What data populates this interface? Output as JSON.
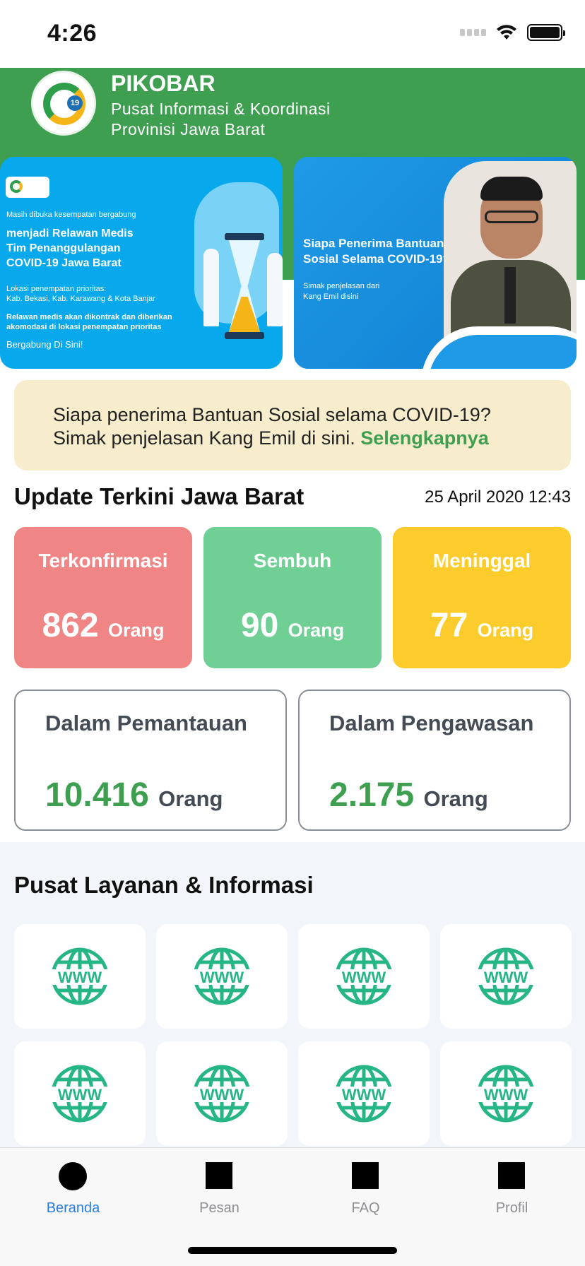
{
  "status_bar": {
    "time": "4:26"
  },
  "header": {
    "title": "PIKOBAR",
    "subtitle_line1": "Pusat Informasi & Koordinasi",
    "subtitle_line2": "Provinisi Jawa Barat"
  },
  "banners": [
    {
      "small": "Masih dibuka kesempatan bergabung",
      "headline": "menjadi Relawan Medis\nTim Penanggulangan\nCOVID-19 Jawa Barat",
      "location": "Lokasi penempatan prioritas:\nKab. Bekasi, Kab. Karawang & Kota Banjar",
      "note": "Relawan medis akan dikontrak dan diberikan\nakomodasi di lokasi penempatan prioritas",
      "cta": "Bergabung Di Sini!"
    },
    {
      "headline": "Siapa Penerima Bantuan\nSosial Selama COVID-19?",
      "sub": "Simak penjelasan dari\nKang Emil disini"
    }
  ],
  "announcement": {
    "line1": "Siapa penerima Bantuan Sosial selama COVID-19?",
    "line2": "Simak penjelasan Kang Emil di sini.",
    "link": "Selengkapnya"
  },
  "update": {
    "title": "Update Terkini Jawa Barat",
    "date": "25 April 2020 12:43",
    "stats": [
      {
        "label": "Terkonfirmasi",
        "value": "862",
        "unit": "Orang",
        "color": "#ef8585"
      },
      {
        "label": "Sembuh",
        "value": "90",
        "unit": "Orang",
        "color": "#6fcf94"
      },
      {
        "label": "Meninggal",
        "value": "77",
        "unit": "Orang",
        "color": "#fccc2c"
      }
    ],
    "monitoring": [
      {
        "label": "Dalam Pemantauan",
        "value": "10.416",
        "unit": "Orang"
      },
      {
        "label": "Dalam Pengawasan",
        "value": "2.175",
        "unit": "Orang"
      }
    ]
  },
  "services": {
    "title": "Pusat Layanan & Informasi",
    "icon": "www-globe-icon",
    "icon_color": "#26b584",
    "icon_text": "WWW"
  },
  "tabbar": {
    "tabs": [
      {
        "label": "Beranda",
        "active": true
      },
      {
        "label": "Pesan",
        "active": false
      },
      {
        "label": "FAQ",
        "active": false
      },
      {
        "label": "Profil",
        "active": false
      }
    ],
    "active_color": "#2a7de1"
  },
  "colors": {
    "brand_green": "#3f9f51",
    "announce_bg": "#f7eccc"
  }
}
